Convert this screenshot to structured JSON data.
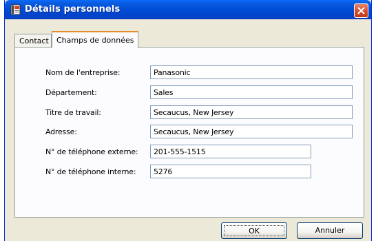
{
  "window": {
    "title": "Détails personnels"
  },
  "tabs": [
    {
      "label": "Contact",
      "active": false
    },
    {
      "label": "Champs de données",
      "active": true
    }
  ],
  "fields": [
    {
      "label": "Nom de l'entreprise:",
      "value": "Panasonic"
    },
    {
      "label": "Département:",
      "value": "Sales"
    },
    {
      "label": "Titre de travail:",
      "value": "Secaucus, New Jersey"
    },
    {
      "label": "Adresse:",
      "value": "Secaucus, New Jersey"
    },
    {
      "label": "N° de téléphone externe:",
      "value": "201-555-1515"
    },
    {
      "label": "N° de téléphone interne:",
      "value": "5276"
    }
  ],
  "buttons": {
    "ok": "OK",
    "cancel": "Annuler"
  },
  "colors": {
    "titlebar": "#0250d8",
    "window_bg": "#ece9d8",
    "panel_bg": "#fcfcfe",
    "active_tab_accent": "#e68b2c",
    "close_button": "#d6502d"
  },
  "icons": {
    "title": "address-book-icon",
    "close": "close-icon"
  }
}
